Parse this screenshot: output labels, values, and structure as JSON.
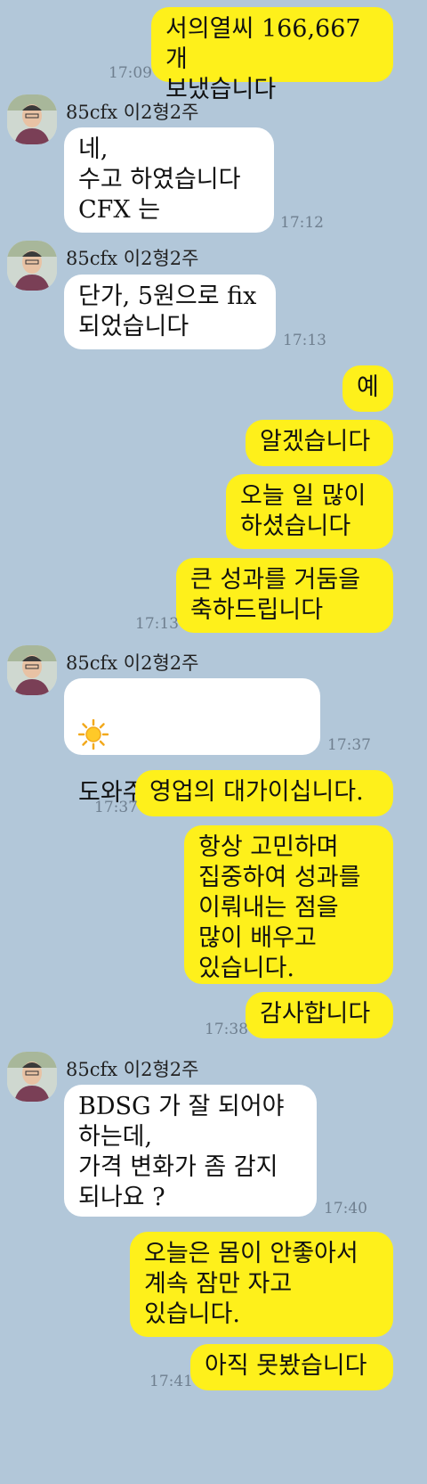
{
  "sender_name": "85cfx 이2형2주",
  "messages": {
    "m1": {
      "text": "서의열씨 166,667개\n보냈습니다",
      "time": "17:09"
    },
    "m2": {
      "text": "네,\n수고 하였습니다\nCFX 는",
      "time": "17:12"
    },
    "m3": {
      "text": "단가, 5원으로 fix\n되었습니다",
      "time": "17:13"
    },
    "m4": {
      "text": "예"
    },
    "m5": {
      "text": "알겠습니다"
    },
    "m6": {
      "text": "오늘 일 많이\n하셨습니다"
    },
    "m7": {
      "text": "큰 성과를 거둠을\n축하드립니다",
      "time": "17:13"
    },
    "m8": {
      "text": "도와주셔  감사합니다",
      "time": "17:37",
      "icon": "sun-icon"
    },
    "m9": {
      "text": "영업의 대가이십니다.",
      "time": "17:37"
    },
    "m10": {
      "text": "항상 고민하며\n집중하여 성과를\n이뤄내는 점을\n많이 배우고\n있습니다."
    },
    "m11": {
      "text": "감사합니다",
      "time": "17:38"
    },
    "m12": {
      "text": "BDSG 가  잘 되어야\n하는데,\n가격 변화가  좀 감지\n되나요 ?",
      "time": "17:40"
    },
    "m13": {
      "text": "오늘은 몸이 안좋아서\n계속 잠만 자고\n있습니다."
    },
    "m14": {
      "text": "아직 못봤습니다",
      "time": "17:41"
    }
  },
  "colors": {
    "background": "#b2c7d9",
    "my_bubble": "#fef01b",
    "their_bubble": "#ffffff"
  }
}
